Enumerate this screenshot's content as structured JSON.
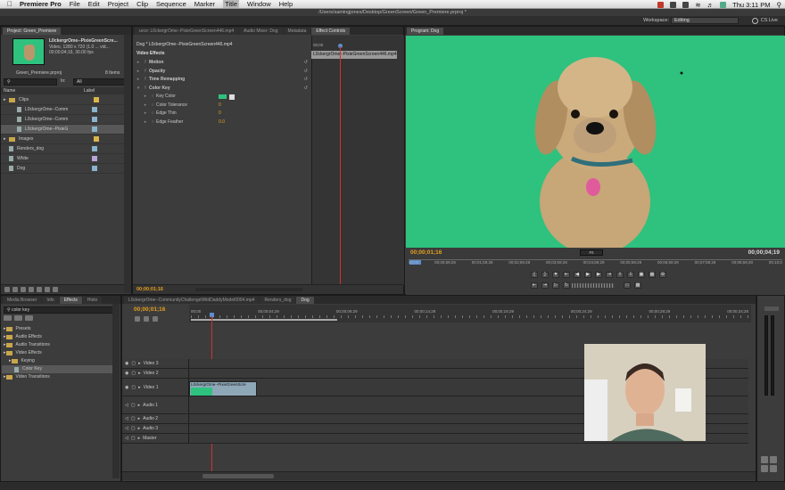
{
  "menubar": {
    "app_name": "Premiere Pro",
    "items": [
      "File",
      "Edit",
      "Project",
      "Clip",
      "Sequence",
      "Marker",
      "Title",
      "Window",
      "Help"
    ],
    "selected": "Title",
    "clock": "Thu 3:11 PM"
  },
  "window_title": "/Users/samingjones/Desktop/GreenScreen/Green_Premiere.prproj *",
  "workspace": {
    "label": "Workspace:",
    "value": "Editing",
    "cs_live": "CS Live"
  },
  "project": {
    "tab_title": "Project: Green_Premiere",
    "clip_name": "L0ckergrOme--PixieGreenScre...",
    "clip_info_1": "Video, 1280 x 720 (1.0 ... vid...",
    "clip_info_2": "00;00;04;19, 30.00 fps",
    "project_file": "Green_Premiere.prproj",
    "item_count": "8 Items",
    "in_label": "In:",
    "in_value": "All",
    "col_name": "Name",
    "col_label": "Label",
    "items": [
      {
        "name": "Clips",
        "type": "folder",
        "indent": 0,
        "color": "#d9b54a"
      },
      {
        "name": "L0ckergrOme--Comm",
        "type": "file",
        "indent": 1,
        "color": "#8ab3cc"
      },
      {
        "name": "L0ckergrOme--Comm",
        "type": "file",
        "indent": 1,
        "color": "#8ab3cc"
      },
      {
        "name": "L0ckergrOme--PixieG",
        "type": "file",
        "indent": 1,
        "color": "#8ab3cc"
      },
      {
        "name": "Images",
        "type": "folder",
        "indent": 0,
        "color": "#d9b54a"
      },
      {
        "name": "Renders_dog",
        "type": "file",
        "indent": 0,
        "color": "#8ab3cc"
      },
      {
        "name": "White",
        "type": "file",
        "indent": 0,
        "color": "#b8a4d8"
      },
      {
        "name": "Dog",
        "type": "file",
        "indent": 0,
        "color": "#8ab3cc"
      }
    ]
  },
  "effect_controls": {
    "tabs": [
      "urce: L0ckergrOme--PixieGreenScreen446.mp4",
      "Audio Mixer: Dog",
      "Metadata",
      "Effect Controls"
    ],
    "active_tab": "Effect Controls",
    "clip_path": "Dog * L0ckergrOme--PixieGreenScreen446.mp4",
    "section": "Video Effects",
    "ruler_start": "00;00",
    "clip_bar": "L0ckergrOme--PixieGreenScreen446.mp4",
    "rows": [
      {
        "label": "Motion",
        "level": 0,
        "value": ""
      },
      {
        "label": "Opacity",
        "level": 0,
        "value": ""
      },
      {
        "label": "Time Remapping",
        "level": 0,
        "value": ""
      },
      {
        "label": "Color Key",
        "level": 0,
        "value": ""
      },
      {
        "label": "Key Color",
        "level": 1,
        "value": ""
      },
      {
        "label": "Color Tolerance",
        "level": 1,
        "value": "0"
      },
      {
        "label": "Edge Thin",
        "level": 1,
        "value": "0"
      },
      {
        "label": "Edge Feather",
        "level": 1,
        "value": "0.0"
      }
    ],
    "key_color": "#2ec27e",
    "timecode": "00;00;01;16"
  },
  "program": {
    "tab_title": "Program: Dog",
    "timecode": "00;00;01;16",
    "duration": "00;00;04;19",
    "fit": "Fit",
    "ruler": [
      "00;00",
      "00;00;59;28",
      "00;01;59;28",
      "00;02;59;28",
      "00;03;59;28",
      "00;04;59;29",
      "00;05;59;29",
      "00;06;59;29",
      "00;07;59;29",
      "00;08;59;30",
      "00;10;0"
    ]
  },
  "effects_panel": {
    "tabs": [
      "Media Browser",
      "Info",
      "Effects",
      "Histo"
    ],
    "active_tab": "Effects",
    "search_value": "color key",
    "tree": [
      {
        "label": "Presets",
        "level": 0
      },
      {
        "label": "Audio Effects",
        "level": 0
      },
      {
        "label": "Audio Transitions",
        "level": 0
      },
      {
        "label": "Video Effects",
        "level": 0
      },
      {
        "label": "Keying",
        "level": 1
      },
      {
        "label": "Color Key",
        "level": 2,
        "selected": true
      },
      {
        "label": "Video Transitions",
        "level": 0
      }
    ]
  },
  "timeline": {
    "tabs": [
      "L0ckergrOme--CommunityChallengeWildDaddyModel0004.mp4",
      "Renders_dog",
      "Dog"
    ],
    "active_tab": "Dog",
    "timecode": "00;00;01;16",
    "ruler": [
      "00;00",
      "00;00;04;29",
      "00;00;09;29",
      "00;00;14;29",
      "00;00;19;29",
      "00;00;24;29",
      "00;00;29;29",
      "00;00;34;28"
    ],
    "tracks": [
      "Video 3",
      "Video 2",
      "Video 1",
      "Audio 1",
      "Audio 2",
      "Audio 3",
      "Master"
    ],
    "clip_label": "L0ckergrOme--PixieGreenScre"
  },
  "colors": {
    "accent_timecode": "#e5a020",
    "green_screen": "#2ec27e",
    "playhead": "#d83030"
  }
}
